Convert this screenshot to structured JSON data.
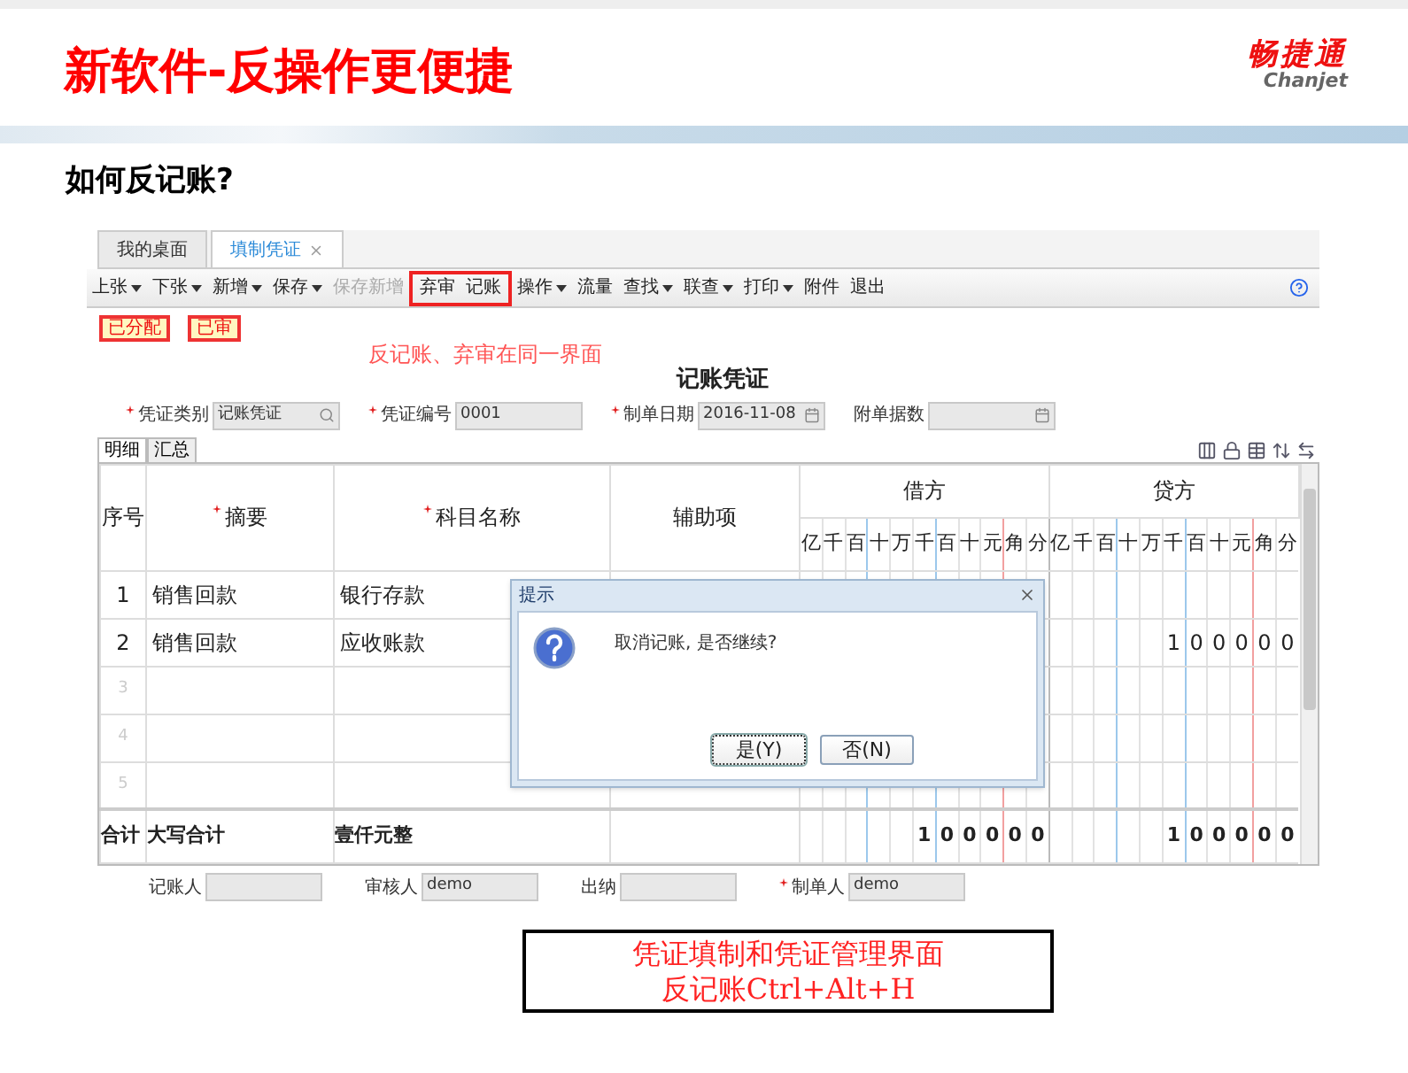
{
  "header": {
    "title": "新软件-反操作更便捷",
    "logo_cn": "畅捷通",
    "logo_en": "Chanjet"
  },
  "subtitle": "如何反记账?",
  "app": {
    "tabs": [
      {
        "label": "我的桌面",
        "selected": false,
        "closable": false
      },
      {
        "label": "填制凭证",
        "selected": true,
        "closable": true
      }
    ],
    "toolbar": [
      {
        "label": "上张",
        "dropdown": true,
        "disabled": false,
        "highlighted": false
      },
      {
        "label": "下张",
        "dropdown": true,
        "disabled": false,
        "highlighted": false
      },
      {
        "label": "新增",
        "dropdown": true,
        "disabled": false,
        "highlighted": false
      },
      {
        "label": "保存",
        "dropdown": true,
        "disabled": false,
        "highlighted": false
      },
      {
        "label": "保存新增",
        "dropdown": false,
        "disabled": true,
        "highlighted": false
      },
      {
        "label": "弃审",
        "dropdown": false,
        "disabled": false,
        "highlighted": true
      },
      {
        "label": "记账",
        "dropdown": false,
        "disabled": false,
        "highlighted": true
      },
      {
        "label": "操作",
        "dropdown": true,
        "disabled": false,
        "highlighted": false
      },
      {
        "label": "流量",
        "dropdown": false,
        "disabled": false,
        "highlighted": false
      },
      {
        "label": "查找",
        "dropdown": true,
        "disabled": false,
        "highlighted": false
      },
      {
        "label": "联查",
        "dropdown": true,
        "disabled": false,
        "highlighted": false
      },
      {
        "label": "打印",
        "dropdown": true,
        "disabled": false,
        "highlighted": false
      },
      {
        "label": "附件",
        "dropdown": false,
        "disabled": false,
        "highlighted": false
      },
      {
        "label": "退出",
        "dropdown": false,
        "disabled": false,
        "highlighted": false
      }
    ],
    "status_badges": [
      "已分配",
      "已审"
    ],
    "annotation": "反记账、弃审在同一界面",
    "voucher_title": "记账凭证",
    "fields": [
      {
        "label": "凭证类别",
        "required": true,
        "value": "记账凭证",
        "kind": "lookup"
      },
      {
        "label": "凭证编号",
        "required": true,
        "value": "0001",
        "kind": "text"
      },
      {
        "label": "制单日期",
        "required": true,
        "value": "2016-11-08",
        "kind": "date"
      },
      {
        "label": "附单据数",
        "required": false,
        "kind": "date"
      }
    ],
    "detail_tabs": [
      {
        "label": "明细",
        "selected": true
      },
      {
        "label": "汇总",
        "selected": false
      }
    ],
    "table": {
      "columns": [
        {
          "label": "序号",
          "required": false
        },
        {
          "label": "摘要",
          "required": true
        },
        {
          "label": "科目名称",
          "required": true
        },
        {
          "label": "辅助项",
          "required": false
        }
      ],
      "amount_groups": [
        {
          "label": "借方",
          "units": [
            "亿",
            "千",
            "百",
            "十",
            "万",
            "千",
            "百",
            "十",
            "元",
            "角",
            "分"
          ]
        },
        {
          "label": "贷方",
          "units": [
            "亿",
            "千",
            "百",
            "十",
            "万",
            "千",
            "百",
            "十",
            "元",
            "角",
            "分"
          ]
        }
      ],
      "rows": [
        {
          "no": "1",
          "summary": "销售回款",
          "account": "银行存款",
          "empty": false
        },
        {
          "no": "2",
          "summary": "销售回款",
          "account": "应收账款",
          "credit": [
            "1",
            "0",
            "0",
            "0",
            "0",
            "0"
          ],
          "empty": false
        },
        {
          "no": "3",
          "empty": true
        },
        {
          "no": "4",
          "empty": true
        },
        {
          "no": "5",
          "empty": true
        }
      ],
      "total": {
        "label": "合计",
        "summary": "大写合计",
        "account": "壹仟元整",
        "debit": [
          "1",
          "0",
          "0",
          "0",
          "0",
          "0"
        ],
        "credit": [
          "1",
          "0",
          "0",
          "0",
          "0",
          "0"
        ]
      }
    },
    "dialog": {
      "title": "提示",
      "message": "取消记账, 是否继续?",
      "buttons": [
        {
          "label": "是(Y)",
          "focused": true
        },
        {
          "label": "否(N)",
          "focused": false
        }
      ]
    },
    "footer_fields": [
      {
        "label": "记账人",
        "required": false
      },
      {
        "label": "审核人",
        "required": false,
        "value": "demo"
      },
      {
        "label": "出纳",
        "required": false
      },
      {
        "label": "制单人",
        "required": true,
        "value": "demo"
      }
    ]
  },
  "note_box": {
    "lines": [
      "凭证填制和凭证管理界面",
      "反记账Ctrl+Alt+H"
    ]
  }
}
